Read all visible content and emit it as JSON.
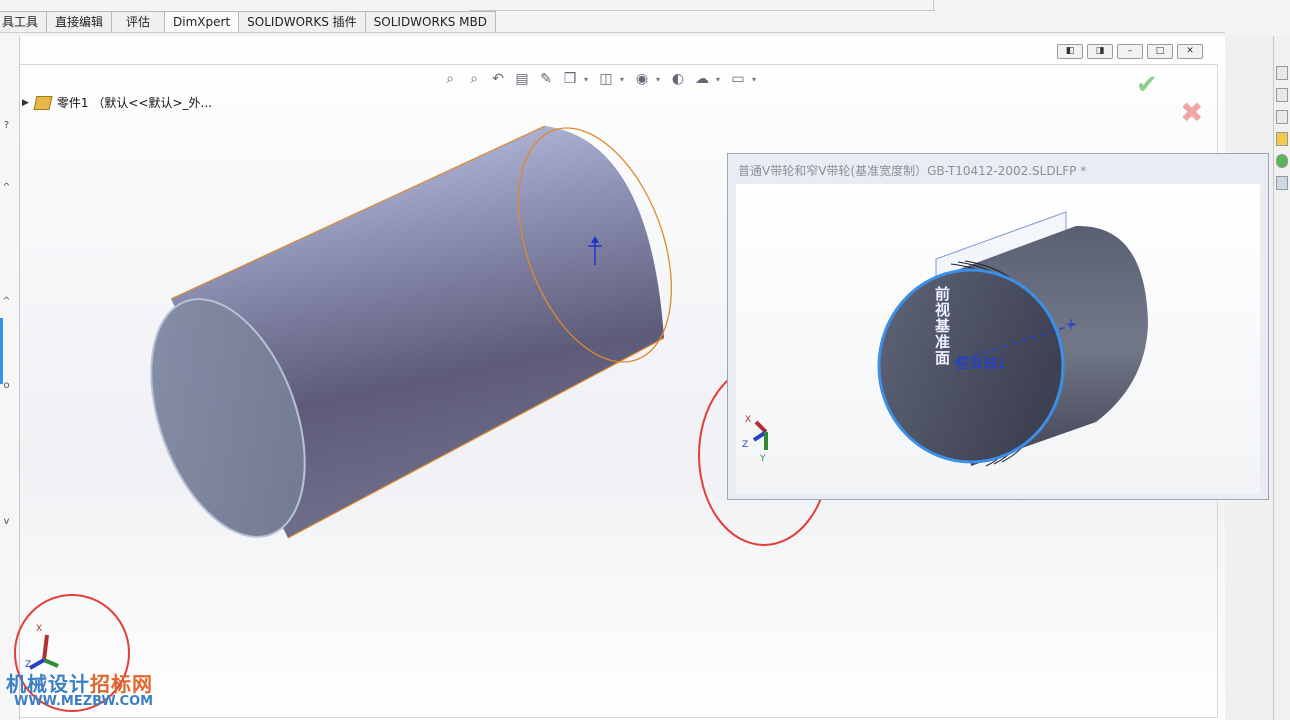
{
  "tabs": [
    {
      "label": "具工具"
    },
    {
      "label": "直接编辑"
    },
    {
      "label": "评估"
    },
    {
      "label": "DimXpert"
    },
    {
      "label": "SOLIDWORKS 插件"
    },
    {
      "label": "SOLIDWORKS MBD"
    }
  ],
  "active_tab": "DimXpert",
  "feature_tree": {
    "root_label": "零件1 （默认<<默认>_外..."
  },
  "icons": {
    "hud": [
      "zoom-to-fit-icon",
      "zoom-to-area-icon",
      "previous-view-icon",
      "section-view-icon",
      "dynamic-annotation-icon",
      "view-orientation-icon",
      "display-style-icon",
      "hide-show-icon",
      "edit-appearance-icon",
      "apply-scene-icon",
      "view-settings-icon"
    ],
    "confirm": "checkmark-icon",
    "cancel": "close-x-icon"
  },
  "window_controls": [
    "restore-left-icon",
    "restore-right-icon",
    "minimize-icon",
    "maximize-icon",
    "close-icon"
  ],
  "preview_window": {
    "title": "普通V带轮和窄V带轮(基准宽度制）GB-T10412-2002.SLDLFP *",
    "axis_label": "基准轴1",
    "plane_label": "前视基准面"
  },
  "triad_labels": {
    "x": "X",
    "y": "Y",
    "z": "Z"
  },
  "watermark": {
    "part1": "机械设计",
    "part2": "招标网",
    "url": "WWW.MEZBW.COM"
  },
  "colors": {
    "accent_ok": "#8ccf8a",
    "accent_cancel": "#f0a6a6",
    "highlight_circle": "#e0403a",
    "edge_orange": "#e08a2a",
    "selection_blue": "#3b8fe8"
  }
}
